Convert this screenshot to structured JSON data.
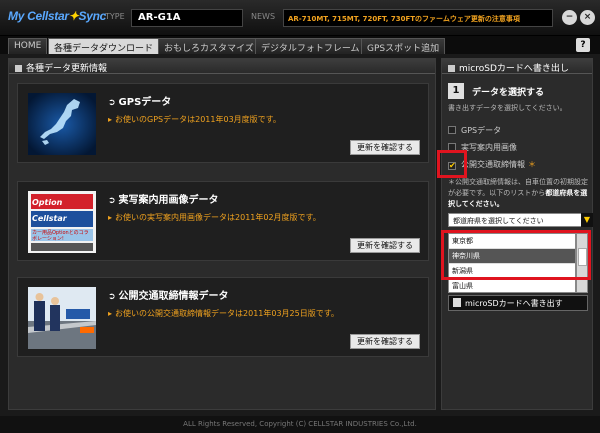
{
  "app": {
    "logo_prefix": "My Cellstar",
    "logo_suffix": "Sync"
  },
  "header": {
    "type_label": "TYPE",
    "type_value": "AR-G1A",
    "news_label": "NEWS",
    "news_text": "AR-710MT, 715MT, 720FT, 730FTのファームウェア更新の注意事項"
  },
  "window": {
    "minimize_label": "−",
    "close_label": "×"
  },
  "tabs": [
    {
      "label": "HOME"
    },
    {
      "label": "各種データダウンロード"
    },
    {
      "label": "おもしろカスタマイズ"
    },
    {
      "label": "デジタルフォトフレーム"
    },
    {
      "label": "GPSスポット追加"
    }
  ],
  "help_label": "?",
  "left": {
    "title": "各種データ更新情報",
    "cards": [
      {
        "title": "GPSデータ",
        "sub": "お使いのGPSデータは2011年03月度版です。",
        "button": "更新を確認する"
      },
      {
        "title": "実写案内用画像データ",
        "sub": "お使いの実写案内用画像データは2011年02月度版です。",
        "button": "更新を確認する",
        "thumb_text": "Option Cellstar",
        "thumb_caption": "カー用品Optionとのコラボレーション!"
      },
      {
        "title": "公開交通取締情報データ",
        "sub": "お使いの公開交通取締情報データは2011年03月25日版です。",
        "button": "更新を確認する"
      }
    ]
  },
  "right": {
    "title": "microSDカードへ書き出し",
    "step_number": "1",
    "step_title": "データを選択する",
    "step_desc": "書き出すデータを選択してください。",
    "options": [
      {
        "label": "GPSデータ",
        "checked": false
      },
      {
        "label": "実写案内用画像",
        "checked": false
      },
      {
        "label": "公開交通取締情報",
        "checked": true,
        "suffix": "＊"
      }
    ],
    "note_1": "＊公開交通取締情報は、自車位置の初期設定が必要です。以下のリストから",
    "note_bold": "都道府県を選択",
    "note_2": "してください。",
    "select_placeholder": "都道府県を選択してください",
    "dropdown_items": [
      "東京都",
      "神奈川県",
      "新潟県",
      "富山県"
    ],
    "selected_index": 1,
    "write_button": "microSDカードへ書き出す"
  },
  "footer": "ALL Rights Reserved, Copyright (C) CELLSTAR INDUSTRIES Co.,Ltd.",
  "colors": {
    "accent_orange": "#f0a21f",
    "highlight_red": "#e0141f",
    "logo_blue": "#5aa9ff"
  }
}
